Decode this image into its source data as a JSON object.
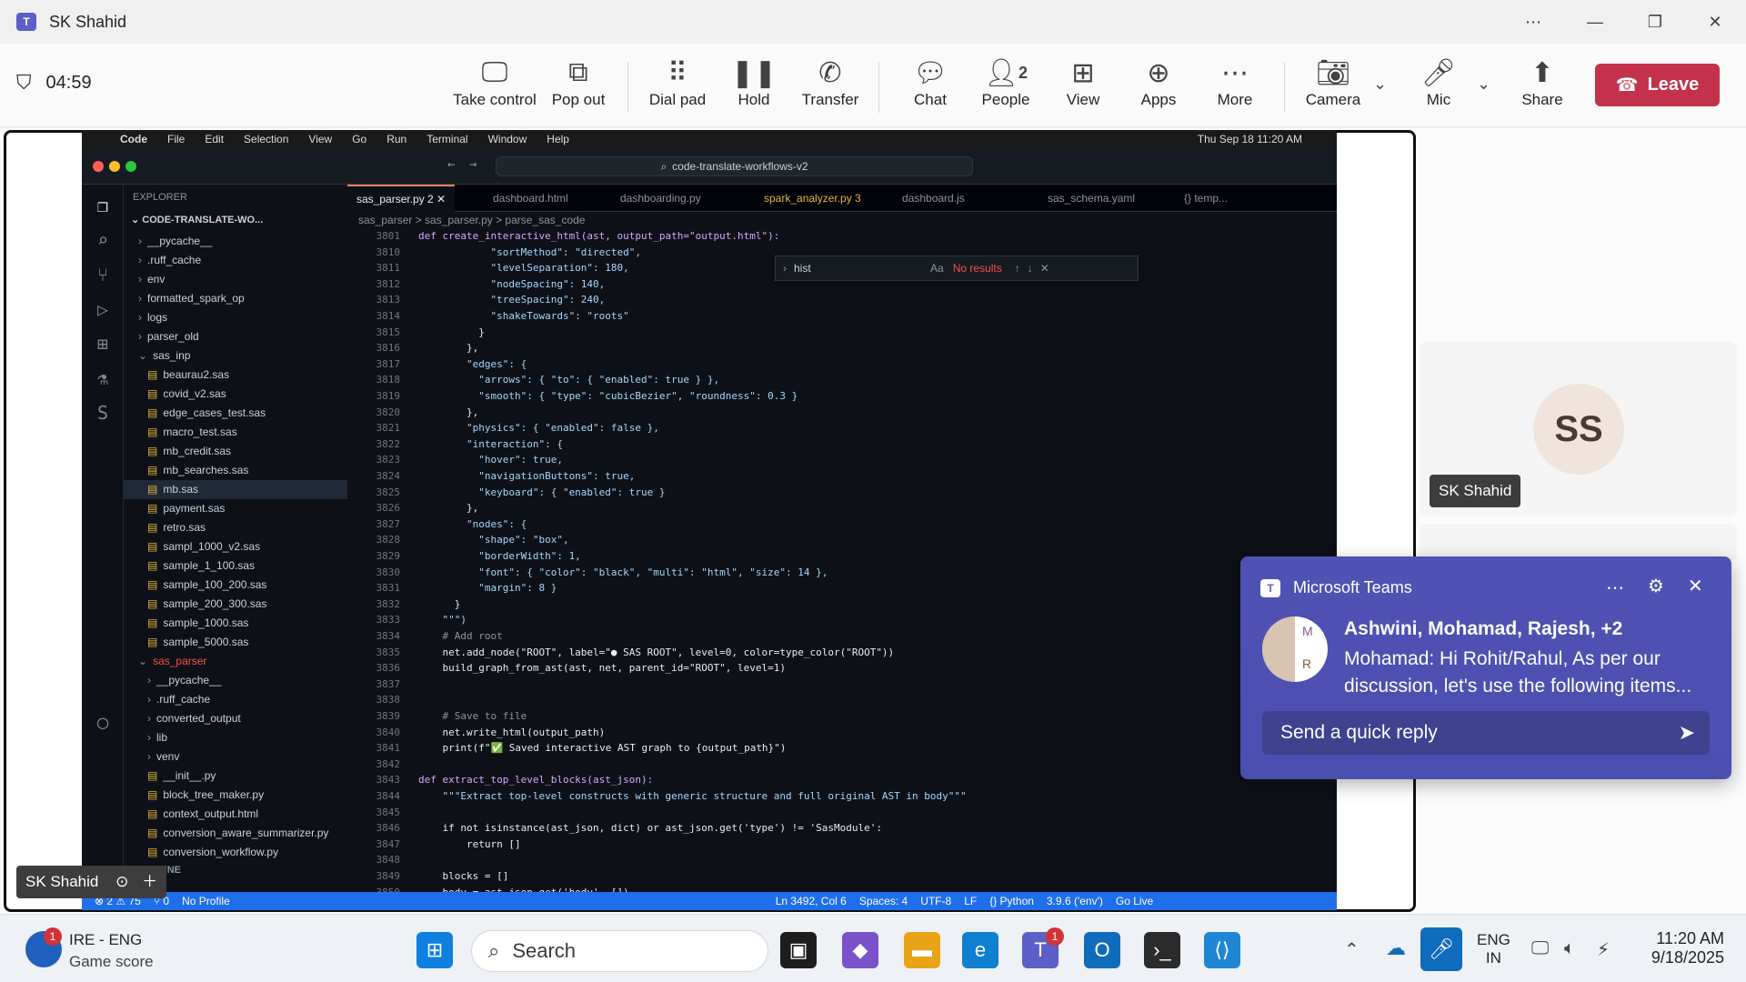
{
  "window": {
    "title": "SK Shahid"
  },
  "meeting": {
    "timer": "04:59",
    "buttons": [
      {
        "label": "Take control",
        "icon": "take-control-icon"
      },
      {
        "label": "Pop out",
        "icon": "pop-out-icon"
      },
      {
        "label": "Dial pad",
        "icon": "dial-pad-icon"
      },
      {
        "label": "Hold",
        "icon": "hold-icon"
      },
      {
        "label": "Transfer",
        "icon": "transfer-icon"
      },
      {
        "label": "Chat",
        "icon": "chat-icon"
      },
      {
        "label": "People",
        "icon": "people-icon",
        "badge": "2"
      },
      {
        "label": "View",
        "icon": "view-icon"
      },
      {
        "label": "Apps",
        "icon": "apps-icon"
      },
      {
        "label": "More",
        "icon": "more-icon"
      },
      {
        "label": "Camera",
        "icon": "camera-off-icon"
      },
      {
        "label": "Mic",
        "icon": "mic-icon"
      },
      {
        "label": "Share",
        "icon": "share-icon"
      }
    ],
    "leave": "Leave",
    "participant": {
      "initials": "SS",
      "name": "SK Shahid"
    },
    "self_name": "SK Shahid"
  },
  "mac_menubar": {
    "items": [
      "Code",
      "File",
      "Edit",
      "Selection",
      "View",
      "Go",
      "Run",
      "Terminal",
      "Window",
      "Help"
    ],
    "clock": "Thu Sep 18  11:20 AM"
  },
  "vscode": {
    "search": "code-translate-workflows-v2",
    "explorer_title": "EXPLORER",
    "project": "CODE-TRANSLATE-WO...",
    "tree": [
      {
        "name": "__pycache__",
        "type": "folder",
        "depth": 1
      },
      {
        "name": ".ruff_cache",
        "type": "folder",
        "depth": 1
      },
      {
        "name": "env",
        "type": "folder",
        "depth": 1
      },
      {
        "name": "formatted_spark_op",
        "type": "folder",
        "depth": 1
      },
      {
        "name": "logs",
        "type": "folder",
        "depth": 1
      },
      {
        "name": "parser_old",
        "type": "folder",
        "depth": 1
      },
      {
        "name": "sas_inp",
        "type": "folder-open",
        "depth": 1
      },
      {
        "name": "beaurau2.sas",
        "type": "file",
        "depth": 2
      },
      {
        "name": "covid_v2.sas",
        "type": "file",
        "depth": 2
      },
      {
        "name": "edge_cases_test.sas",
        "type": "file",
        "depth": 2
      },
      {
        "name": "macro_test.sas",
        "type": "file",
        "depth": 2
      },
      {
        "name": "mb_credit.sas",
        "type": "file",
        "depth": 2
      },
      {
        "name": "mb_searches.sas",
        "type": "file",
        "depth": 2
      },
      {
        "name": "mb.sas",
        "type": "file",
        "depth": 2,
        "selected": true
      },
      {
        "name": "payment.sas",
        "type": "file",
        "depth": 2
      },
      {
        "name": "retro.sas",
        "type": "file",
        "depth": 2
      },
      {
        "name": "sampl_1000_v2.sas",
        "type": "file",
        "depth": 2
      },
      {
        "name": "sample_1_100.sas",
        "type": "file",
        "depth": 2
      },
      {
        "name": "sample_100_200.sas",
        "type": "file",
        "depth": 2
      },
      {
        "name": "sample_200_300.sas",
        "type": "file",
        "depth": 2
      },
      {
        "name": "sample_1000.sas",
        "type": "file",
        "depth": 2
      },
      {
        "name": "sample_5000.sas",
        "type": "file",
        "depth": 2
      },
      {
        "name": "sas_parser",
        "type": "folder-open",
        "depth": 1,
        "modified": true
      },
      {
        "name": "__pycache__",
        "type": "folder",
        "depth": 2
      },
      {
        "name": ".ruff_cache",
        "type": "folder",
        "depth": 2
      },
      {
        "name": "converted_output",
        "type": "folder",
        "depth": 2
      },
      {
        "name": "lib",
        "type": "folder",
        "depth": 2
      },
      {
        "name": "venv",
        "type": "folder",
        "depth": 2
      },
      {
        "name": "__init__.py",
        "type": "file",
        "depth": 2
      },
      {
        "name": "block_tree_maker.py",
        "type": "file",
        "depth": 2
      },
      {
        "name": "context_output.html",
        "type": "file",
        "depth": 2
      },
      {
        "name": "conversion_aware_summarizer.py",
        "type": "file",
        "depth": 2
      },
      {
        "name": "conversion_workflow.py",
        "type": "file",
        "depth": 2
      }
    ],
    "outline": "OUTLINE",
    "timeline": "TIMELINE",
    "tabs": [
      {
        "label": "sas_parser.py 2",
        "active": true
      },
      {
        "label": "dashboard.html"
      },
      {
        "label": "dashboarding.py"
      },
      {
        "label": "spark_analyzer.py 3"
      },
      {
        "label": "dashboard.js"
      },
      {
        "label": "sas_schema.yaml"
      },
      {
        "label": "{} temp..."
      }
    ],
    "breadcrumb": "sas_parser  >  sas_parser.py  >  parse_sas_code",
    "find": {
      "query": "hist",
      "result": "No results"
    },
    "code_lines": [
      {
        "n": "3801",
        "t": "def create_interactive_html(ast, output_path=\"output.html\"):"
      },
      {
        "n": "3810",
        "t": "            \"sortMethod\": \"directed\","
      },
      {
        "n": "3811",
        "t": "            \"levelSeparation\": 180,"
      },
      {
        "n": "3812",
        "t": "            \"nodeSpacing\": 140,"
      },
      {
        "n": "3813",
        "t": "            \"treeSpacing\": 240,"
      },
      {
        "n": "3814",
        "t": "            \"shakeTowards\": \"roots\""
      },
      {
        "n": "3815",
        "t": "          }"
      },
      {
        "n": "3816",
        "t": "        },"
      },
      {
        "n": "3817",
        "t": "        \"edges\": {"
      },
      {
        "n": "3818",
        "t": "          \"arrows\": { \"to\": { \"enabled\": true } },"
      },
      {
        "n": "3819",
        "t": "          \"smooth\": { \"type\": \"cubicBezier\", \"roundness\": 0.3 }"
      },
      {
        "n": "3820",
        "t": "        },"
      },
      {
        "n": "3821",
        "t": "        \"physics\": { \"enabled\": false },"
      },
      {
        "n": "3822",
        "t": "        \"interaction\": {"
      },
      {
        "n": "3823",
        "t": "          \"hover\": true,"
      },
      {
        "n": "3824",
        "t": "          \"navigationButtons\": true,"
      },
      {
        "n": "3825",
        "t": "          \"keyboard\": { \"enabled\": true }"
      },
      {
        "n": "3826",
        "t": "        },"
      },
      {
        "n": "3827",
        "t": "        \"nodes\": {"
      },
      {
        "n": "3828",
        "t": "          \"shape\": \"box\","
      },
      {
        "n": "3829",
        "t": "          \"borderWidth\": 1,"
      },
      {
        "n": "3830",
        "t": "          \"font\": { \"color\": \"black\", \"multi\": \"html\", \"size\": 14 },"
      },
      {
        "n": "3831",
        "t": "          \"margin\": 8 }"
      },
      {
        "n": "3832",
        "t": "      }"
      },
      {
        "n": "3833",
        "t": "    \"\"\")"
      },
      {
        "n": "3834",
        "t": "    # Add root"
      },
      {
        "n": "3835",
        "t": "    net.add_node(\"ROOT\", label=\"● SAS ROOT\", level=0, color=type_color(\"ROOT\"))"
      },
      {
        "n": "3836",
        "t": "    build_graph_from_ast(ast, net, parent_id=\"ROOT\", level=1)"
      },
      {
        "n": "3837",
        "t": ""
      },
      {
        "n": "3838",
        "t": ""
      },
      {
        "n": "3839",
        "t": "    # Save to file"
      },
      {
        "n": "3840",
        "t": "    net.write_html(output_path)"
      },
      {
        "n": "3841",
        "t": "    print(f\"✅ Saved interactive AST graph to {output_path}\")"
      },
      {
        "n": "3842",
        "t": ""
      },
      {
        "n": "3843",
        "t": "def extract_top_level_blocks(ast_json):"
      },
      {
        "n": "3844",
        "t": "    \"\"\"Extract top-level constructs with generic structure and full original AST in body\"\"\""
      },
      {
        "n": "3845",
        "t": ""
      },
      {
        "n": "3846",
        "t": "    if not isinstance(ast_json, dict) or ast_json.get('type') != 'SasModule':"
      },
      {
        "n": "3847",
        "t": "        return []"
      },
      {
        "n": "3848",
        "t": ""
      },
      {
        "n": "3849",
        "t": "    blocks = []"
      },
      {
        "n": "3850",
        "t": "    body = ast_json.get('body', [])"
      }
    ],
    "status": [
      "⊗ 2 ⚠ 75",
      "⑂ 0",
      "No Profile",
      "Ln 3492, Col 6",
      "Spaces: 4",
      "UTF-8",
      "LF",
      "{} Python",
      "3.9.6 ('env')",
      "Go Live"
    ]
  },
  "toast": {
    "app": "Microsoft Teams",
    "sender": "Ashwini, Mohamad, Rajesh, +2",
    "message": "Mohamad: Hi Rohit/Rahul, As per our discussion, let's use the following items...",
    "reply_placeholder": "Send a quick reply",
    "avatar_letters": [
      "M",
      "R"
    ]
  },
  "taskbar": {
    "widget_title": "IRE - ENG",
    "widget_sub": "Game score",
    "widget_badge": "1",
    "search": "Search",
    "teams_badge": "1",
    "lang_top": "ENG",
    "lang_bottom": "IN",
    "time": "11:20 AM",
    "date": "9/18/2025"
  },
  "colors": {
    "leave": "#c4314b",
    "teams": "#5b5fc7",
    "vscode_status": "#1f6feb"
  }
}
